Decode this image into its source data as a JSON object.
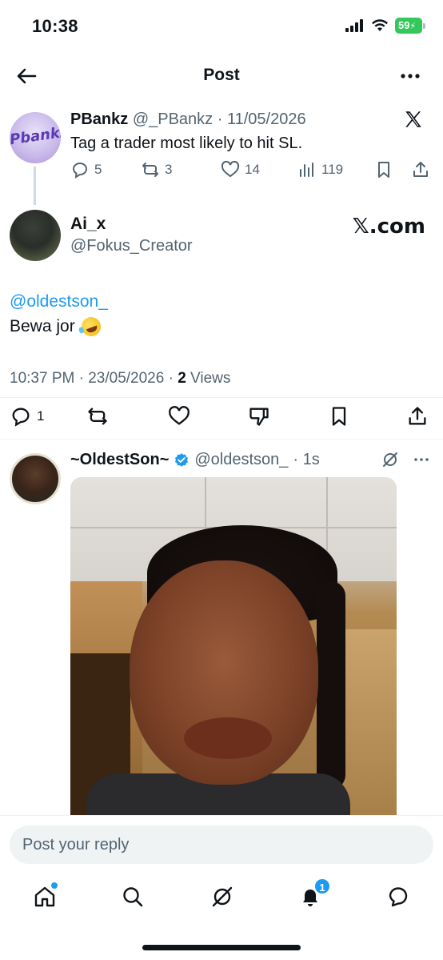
{
  "status_bar": {
    "time": "10:38",
    "battery": "59"
  },
  "nav": {
    "title": "Post"
  },
  "quoted_post": {
    "avatar_text": "Pbankz",
    "name": "PBankz",
    "handle": "@_PBankz",
    "separator": " · ",
    "date": "11/05/2026",
    "text": "Tag a trader most likely to hit SL.",
    "replies": "5",
    "reposts": "3",
    "likes": "14",
    "views": "119"
  },
  "main_post": {
    "name": "Ai_x",
    "handle": "@Fokus_Creator",
    "watermark": "𝕏.com",
    "mention": "@oldestson_",
    "text": "Bewa jor",
    "timestamp": "10:37 PM · 23/05/2026 · ",
    "views_count": "2",
    "views_label": " Views",
    "replies": "1"
  },
  "reply_post": {
    "name": "~OldestSon~",
    "handle": "@oldestson_",
    "time": " · 1s"
  },
  "reply_bar": {
    "placeholder": "Post your reply"
  },
  "tabs": {
    "notifications_badge": "1"
  },
  "colors": {
    "accent": "#1d9bf0",
    "muted": "#536471",
    "text": "#0f1419"
  }
}
